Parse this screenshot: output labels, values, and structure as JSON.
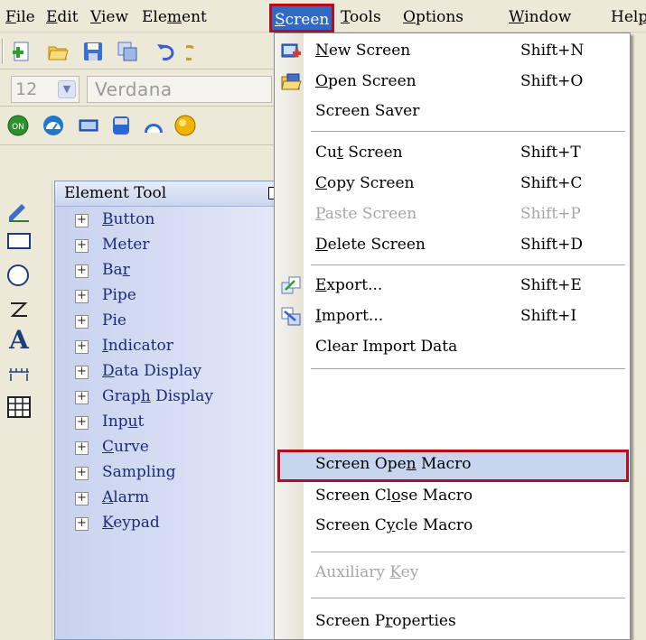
{
  "menubar": {
    "items": [
      {
        "label": "File",
        "key": "F",
        "rest": "ile"
      },
      {
        "label": "Edit",
        "key": "E",
        "rest": "dit"
      },
      {
        "label": "View",
        "key": "V",
        "rest": "iew"
      },
      {
        "label": "Element",
        "pre": "Ele",
        "key": "m",
        "rest": "ent"
      },
      {
        "label": "Screen",
        "key": "S",
        "rest": "creen"
      },
      {
        "label": "Tools",
        "key": "T",
        "rest": "ools"
      },
      {
        "label": "Options",
        "key": "O",
        "rest": "ptions"
      },
      {
        "label": "Window",
        "key": "W",
        "rest": "indow"
      },
      {
        "label": "Help",
        "pre": "Hel",
        "key": "p",
        "rest": ""
      }
    ],
    "active": "Screen"
  },
  "toolbar_font": {
    "size": "12",
    "name": "Verdana"
  },
  "element_panel": {
    "title": "Element Tool",
    "items": [
      {
        "pre": "",
        "key": "B",
        "rest": "utton"
      },
      {
        "pre": "Meter",
        "key": "",
        "rest": ""
      },
      {
        "pre": "Ba",
        "key": "r",
        "rest": ""
      },
      {
        "pre": "Pipe",
        "key": "",
        "rest": ""
      },
      {
        "pre": "Pie",
        "key": "",
        "rest": ""
      },
      {
        "pre": "",
        "key": "I",
        "rest": "ndicator"
      },
      {
        "pre": "",
        "key": "D",
        "rest": "ata Display"
      },
      {
        "pre": "Grap",
        "key": "h",
        "rest": " Display"
      },
      {
        "pre": "Inp",
        "key": "u",
        "rest": "t"
      },
      {
        "pre": "",
        "key": "C",
        "rest": "urve"
      },
      {
        "pre": "Sampling",
        "key": "",
        "rest": ""
      },
      {
        "pre": "",
        "key": "A",
        "rest": "larm"
      },
      {
        "pre": "",
        "key": "K",
        "rest": "eypad"
      }
    ]
  },
  "screen_menu": {
    "items": [
      {
        "pre": "",
        "key": "N",
        "rest": "ew Screen",
        "shortcut": "Shift+N",
        "icon": "new-screen-icon",
        "disabled": false
      },
      {
        "pre": "",
        "key": "O",
        "rest": "pen Screen",
        "shortcut": "Shift+O",
        "icon": "open-screen-icon",
        "disabled": false
      },
      {
        "pre": "Screen Saver",
        "key": "",
        "rest": "",
        "shortcut": "",
        "icon": "",
        "disabled": false
      },
      {
        "pre": "Cu",
        "key": "t",
        "rest": " Screen",
        "shortcut": "Shift+T",
        "icon": "",
        "disabled": false
      },
      {
        "pre": "",
        "key": "C",
        "rest": "opy Screen",
        "shortcut": "Shift+C",
        "icon": "",
        "disabled": false
      },
      {
        "pre": "",
        "key": "P",
        "rest": "aste Screen",
        "shortcut": "Shift+P",
        "icon": "",
        "disabled": true
      },
      {
        "pre": "",
        "key": "D",
        "rest": "elete Screen",
        "shortcut": "Shift+D",
        "icon": "",
        "disabled": false
      },
      {
        "pre": "",
        "key": "E",
        "rest": "xport...",
        "shortcut": "Shift+E",
        "icon": "export-icon",
        "disabled": false
      },
      {
        "pre": "",
        "key": "I",
        "rest": "mport...",
        "shortcut": "Shift+I",
        "icon": "import-icon",
        "disabled": false
      },
      {
        "pre": "Clear Import Data",
        "key": "",
        "rest": "",
        "shortcut": "",
        "icon": "",
        "disabled": false
      },
      {
        "pre": "Screen Ope",
        "key": "n",
        "rest": " Macro",
        "shortcut": "",
        "icon": "",
        "disabled": false,
        "highlighted": true
      },
      {
        "pre": "Screen Cl",
        "key": "o",
        "rest": "se Macro",
        "shortcut": "",
        "icon": "",
        "disabled": false
      },
      {
        "pre": "Screen C",
        "key": "y",
        "rest": "cle Macro",
        "shortcut": "",
        "icon": "",
        "disabled": false
      },
      {
        "pre": "Auxiliary ",
        "key": "K",
        "rest": "ey",
        "shortcut": "",
        "icon": "",
        "disabled": true
      },
      {
        "pre": "Screen P",
        "key": "r",
        "rest": "operties",
        "shortcut": "",
        "icon": "",
        "disabled": false
      }
    ]
  },
  "colors": {
    "highlight_border": "#b40d1e",
    "menu_active_bg": "#316ac5",
    "item_highlight_bg": "#c8d5ef"
  }
}
